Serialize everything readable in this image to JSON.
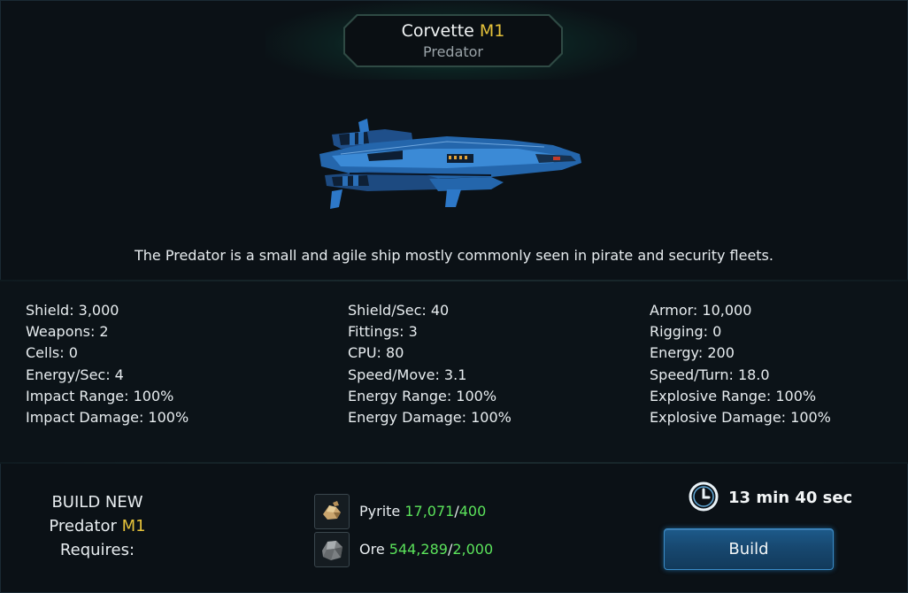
{
  "header": {
    "ship_class": "Corvette",
    "ship_mark": "M1",
    "ship_name": "Predator"
  },
  "ship_image": {
    "icon": "predator-ship-image"
  },
  "description": "The Predator is a small and agile ship mostly commonly seen in pirate and security fleets.",
  "stats": {
    "col1": [
      "Shield: 3,000",
      "Weapons: 2",
      "Cells: 0",
      "Energy/Sec: 4",
      "Impact Range: 100%",
      "Impact Damage: 100%"
    ],
    "col2": [
      "Shield/Sec: 40",
      "Fittings: 3",
      "CPU: 80",
      "Speed/Move: 3.1",
      "Energy Range: 100%",
      "Energy Damage: 100%"
    ],
    "col3": [
      "Armor: 10,000",
      "Rigging: 0",
      "Energy: 200",
      "Speed/Turn: 18.0",
      "Explosive Range: 100%",
      "Explosive Damage: 100%"
    ]
  },
  "build": {
    "line1": "BUILD NEW",
    "ship_name": "Predator",
    "ship_mark": "M1",
    "line3": "Requires:",
    "resources": [
      {
        "name": "Pyrite",
        "have": "17,071",
        "need": "400",
        "icon": "pyrite-icon"
      },
      {
        "name": "Ore",
        "have": "544,289",
        "need": "2,000",
        "icon": "ore-icon"
      }
    ],
    "timer_icon": "clock-icon",
    "time": "13 min 40 sec",
    "button_label": "Build"
  },
  "colors": {
    "accent_gold": "#e5c23a",
    "resource_green": "#5be35b",
    "button_blue": "#1d5a8a",
    "header_glow": "#1ec88c"
  }
}
